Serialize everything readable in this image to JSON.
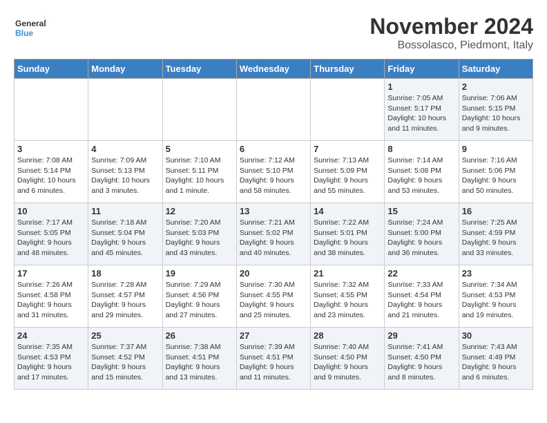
{
  "logo": {
    "line1": "General",
    "line2": "Blue"
  },
  "title": "November 2024",
  "location": "Bossolasco, Piedmont, Italy",
  "weekdays": [
    "Sunday",
    "Monday",
    "Tuesday",
    "Wednesday",
    "Thursday",
    "Friday",
    "Saturday"
  ],
  "weeks": [
    [
      {
        "day": "",
        "info": ""
      },
      {
        "day": "",
        "info": ""
      },
      {
        "day": "",
        "info": ""
      },
      {
        "day": "",
        "info": ""
      },
      {
        "day": "",
        "info": ""
      },
      {
        "day": "1",
        "info": "Sunrise: 7:05 AM\nSunset: 5:17 PM\nDaylight: 10 hours and 11 minutes."
      },
      {
        "day": "2",
        "info": "Sunrise: 7:06 AM\nSunset: 5:15 PM\nDaylight: 10 hours and 9 minutes."
      }
    ],
    [
      {
        "day": "3",
        "info": "Sunrise: 7:08 AM\nSunset: 5:14 PM\nDaylight: 10 hours and 6 minutes."
      },
      {
        "day": "4",
        "info": "Sunrise: 7:09 AM\nSunset: 5:13 PM\nDaylight: 10 hours and 3 minutes."
      },
      {
        "day": "5",
        "info": "Sunrise: 7:10 AM\nSunset: 5:11 PM\nDaylight: 10 hours and 1 minute."
      },
      {
        "day": "6",
        "info": "Sunrise: 7:12 AM\nSunset: 5:10 PM\nDaylight: 9 hours and 58 minutes."
      },
      {
        "day": "7",
        "info": "Sunrise: 7:13 AM\nSunset: 5:09 PM\nDaylight: 9 hours and 55 minutes."
      },
      {
        "day": "8",
        "info": "Sunrise: 7:14 AM\nSunset: 5:08 PM\nDaylight: 9 hours and 53 minutes."
      },
      {
        "day": "9",
        "info": "Sunrise: 7:16 AM\nSunset: 5:06 PM\nDaylight: 9 hours and 50 minutes."
      }
    ],
    [
      {
        "day": "10",
        "info": "Sunrise: 7:17 AM\nSunset: 5:05 PM\nDaylight: 9 hours and 48 minutes."
      },
      {
        "day": "11",
        "info": "Sunrise: 7:18 AM\nSunset: 5:04 PM\nDaylight: 9 hours and 45 minutes."
      },
      {
        "day": "12",
        "info": "Sunrise: 7:20 AM\nSunset: 5:03 PM\nDaylight: 9 hours and 43 minutes."
      },
      {
        "day": "13",
        "info": "Sunrise: 7:21 AM\nSunset: 5:02 PM\nDaylight: 9 hours and 40 minutes."
      },
      {
        "day": "14",
        "info": "Sunrise: 7:22 AM\nSunset: 5:01 PM\nDaylight: 9 hours and 38 minutes."
      },
      {
        "day": "15",
        "info": "Sunrise: 7:24 AM\nSunset: 5:00 PM\nDaylight: 9 hours and 36 minutes."
      },
      {
        "day": "16",
        "info": "Sunrise: 7:25 AM\nSunset: 4:59 PM\nDaylight: 9 hours and 33 minutes."
      }
    ],
    [
      {
        "day": "17",
        "info": "Sunrise: 7:26 AM\nSunset: 4:58 PM\nDaylight: 9 hours and 31 minutes."
      },
      {
        "day": "18",
        "info": "Sunrise: 7:28 AM\nSunset: 4:57 PM\nDaylight: 9 hours and 29 minutes."
      },
      {
        "day": "19",
        "info": "Sunrise: 7:29 AM\nSunset: 4:56 PM\nDaylight: 9 hours and 27 minutes."
      },
      {
        "day": "20",
        "info": "Sunrise: 7:30 AM\nSunset: 4:55 PM\nDaylight: 9 hours and 25 minutes."
      },
      {
        "day": "21",
        "info": "Sunrise: 7:32 AM\nSunset: 4:55 PM\nDaylight: 9 hours and 23 minutes."
      },
      {
        "day": "22",
        "info": "Sunrise: 7:33 AM\nSunset: 4:54 PM\nDaylight: 9 hours and 21 minutes."
      },
      {
        "day": "23",
        "info": "Sunrise: 7:34 AM\nSunset: 4:53 PM\nDaylight: 9 hours and 19 minutes."
      }
    ],
    [
      {
        "day": "24",
        "info": "Sunrise: 7:35 AM\nSunset: 4:53 PM\nDaylight: 9 hours and 17 minutes."
      },
      {
        "day": "25",
        "info": "Sunrise: 7:37 AM\nSunset: 4:52 PM\nDaylight: 9 hours and 15 minutes."
      },
      {
        "day": "26",
        "info": "Sunrise: 7:38 AM\nSunset: 4:51 PM\nDaylight: 9 hours and 13 minutes."
      },
      {
        "day": "27",
        "info": "Sunrise: 7:39 AM\nSunset: 4:51 PM\nDaylight: 9 hours and 11 minutes."
      },
      {
        "day": "28",
        "info": "Sunrise: 7:40 AM\nSunset: 4:50 PM\nDaylight: 9 hours and 9 minutes."
      },
      {
        "day": "29",
        "info": "Sunrise: 7:41 AM\nSunset: 4:50 PM\nDaylight: 9 hours and 8 minutes."
      },
      {
        "day": "30",
        "info": "Sunrise: 7:43 AM\nSunset: 4:49 PM\nDaylight: 9 hours and 6 minutes."
      }
    ]
  ]
}
